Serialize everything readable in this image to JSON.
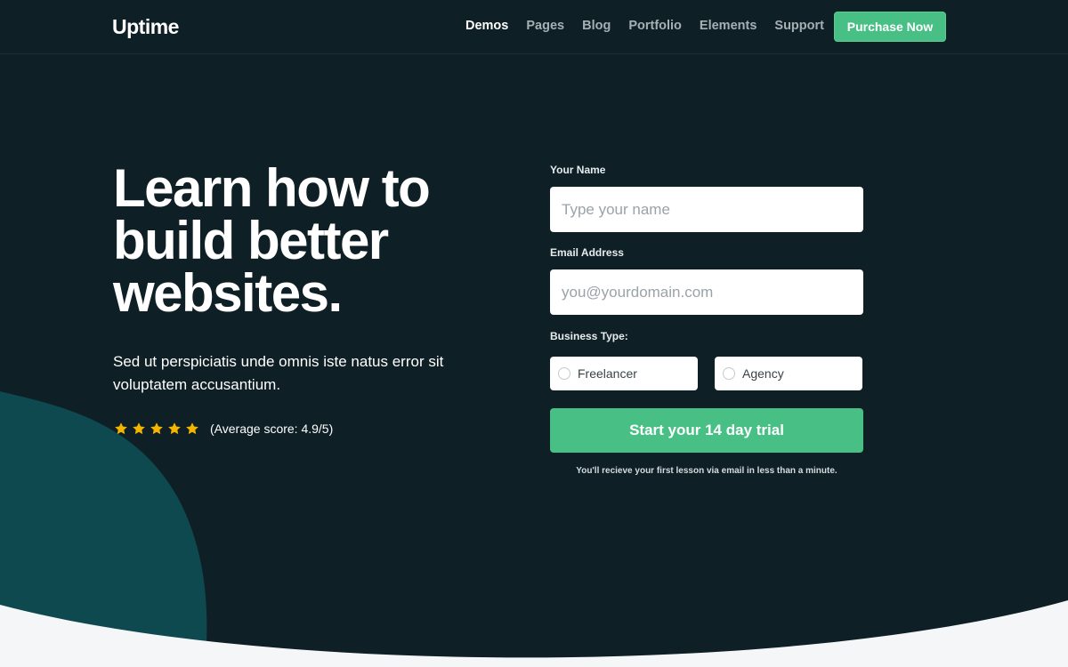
{
  "nav": {
    "logo": "Uptime",
    "links": [
      {
        "label": "Demos",
        "active": true
      },
      {
        "label": "Pages",
        "active": false
      },
      {
        "label": "Blog",
        "active": false
      },
      {
        "label": "Portfolio",
        "active": false
      },
      {
        "label": "Elements",
        "active": false
      },
      {
        "label": "Support",
        "active": false
      }
    ],
    "cta_label": "Purchase Now"
  },
  "hero": {
    "title": "Learn how to build better websites.",
    "subtitle": "Sed ut perspiciatis unde omnis iste natus error sit voluptatem accusantium.",
    "rating": {
      "stars": 5,
      "text": "(Average score: 4.9/5)"
    }
  },
  "form": {
    "name_label": "Your Name",
    "name_placeholder": "Type your name",
    "email_label": "Email Address",
    "email_placeholder": "you@yourdomain.com",
    "business_type_label": "Business Type:",
    "business_options": [
      "Freelancer",
      "Agency"
    ],
    "submit_label": "Start your 14 day trial",
    "note": "You'll recieve your first lesson via email in less than a minute."
  },
  "colors": {
    "background": "#0f1f26",
    "accent": "#48bf84",
    "teal_shape": "#0f4950",
    "star": "#f5b400",
    "bottom_section": "#f4f6f8"
  },
  "icons": {
    "star": "star-icon",
    "radio": "radio-circle-icon"
  }
}
